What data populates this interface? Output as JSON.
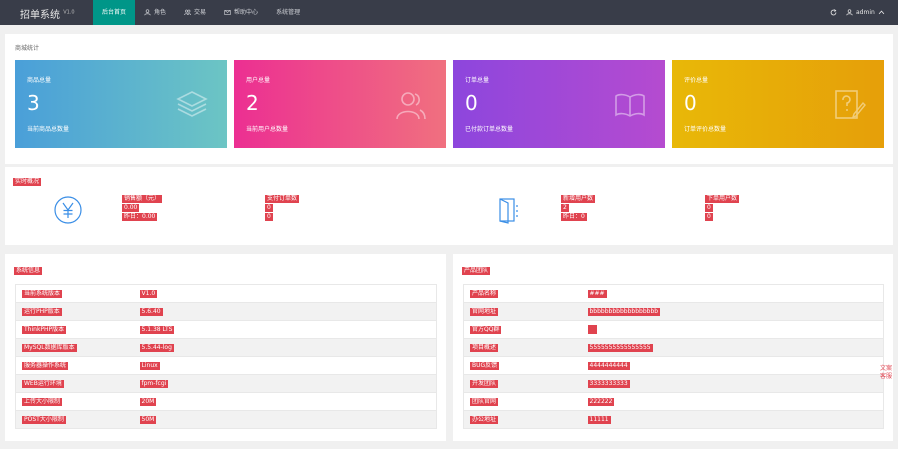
{
  "header": {
    "app_title": "招单系统",
    "version": "V1.0",
    "nav": [
      {
        "label": "后台首页",
        "icon": "home-icon"
      },
      {
        "label": "角色",
        "icon": "user-icon"
      },
      {
        "label": "交易",
        "icon": "users-icon"
      },
      {
        "label": "帮助中心",
        "icon": "help-icon"
      },
      {
        "label": "系统管理",
        "icon": ""
      }
    ],
    "user_name": "admin"
  },
  "stats": {
    "section_title": "商城统计",
    "cards": [
      {
        "title": "商品总量",
        "value": "3",
        "desc": "当前商品总数量",
        "icon": "layers-icon"
      },
      {
        "title": "用户总量",
        "value": "2",
        "desc": "当前用户总数量",
        "icon": "users-icon"
      },
      {
        "title": "订单总量",
        "value": "0",
        "desc": "已付款订单总数量",
        "icon": "book-icon"
      },
      {
        "title": "评价总量",
        "value": "0",
        "desc": "订单评价总数量",
        "icon": "question-edit-icon"
      }
    ]
  },
  "realtime": {
    "title": "实时概况",
    "sales_label": "销售额（元）",
    "sales_value": "0.00",
    "sales_yesterday": "昨日：0.00",
    "orders_label": "支付订单数",
    "orders_value": "0",
    "orders_yesterday": "0",
    "new_users_label": "新增用户数",
    "new_users_value": "2",
    "new_users_yesterday": "昨日：0",
    "buyers_label": "下单用户数",
    "buyers_value": "0",
    "buyers_yesterday": "0"
  },
  "system_info": {
    "title": "系统信息",
    "rows": [
      {
        "label": "当前系统版本",
        "value": "V1.0"
      },
      {
        "label": "运行PHP版本",
        "value": "5.6.40"
      },
      {
        "label": "ThinkPHP版本",
        "value": "5.1.38 LTS"
      },
      {
        "label": "MySQL数据库版本",
        "value": "5.5.44-log"
      },
      {
        "label": "服务器操作系统",
        "value": "Linux"
      },
      {
        "label": "WEB运行环境",
        "value": "fpm-fcgi"
      },
      {
        "label": "上传大小限制",
        "value": "20M"
      },
      {
        "label": "POST大小限制",
        "value": "50M"
      }
    ]
  },
  "product_info": {
    "title": "产品团队",
    "rows": [
      {
        "label": "产品名称",
        "value": "###"
      },
      {
        "label": "官网地址",
        "value": "bbbbbbbbbbbbbbbbbb"
      },
      {
        "label": "官方QQ群",
        "value": ""
      },
      {
        "label": "项目概述",
        "value": "5555555555555555"
      },
      {
        "label": "BUG反馈",
        "value": "4444444444"
      },
      {
        "label": "开发团队",
        "value": "3333333333"
      },
      {
        "label": "团队官网",
        "value": "222222"
      },
      {
        "label": "办公地址",
        "value": "11111"
      }
    ]
  },
  "side_tag": {
    "line1": "文案",
    "line2": "客服"
  },
  "colors": {
    "topbar": "#393d49",
    "active_tab": "#009688",
    "highlight": "#e0434f"
  }
}
